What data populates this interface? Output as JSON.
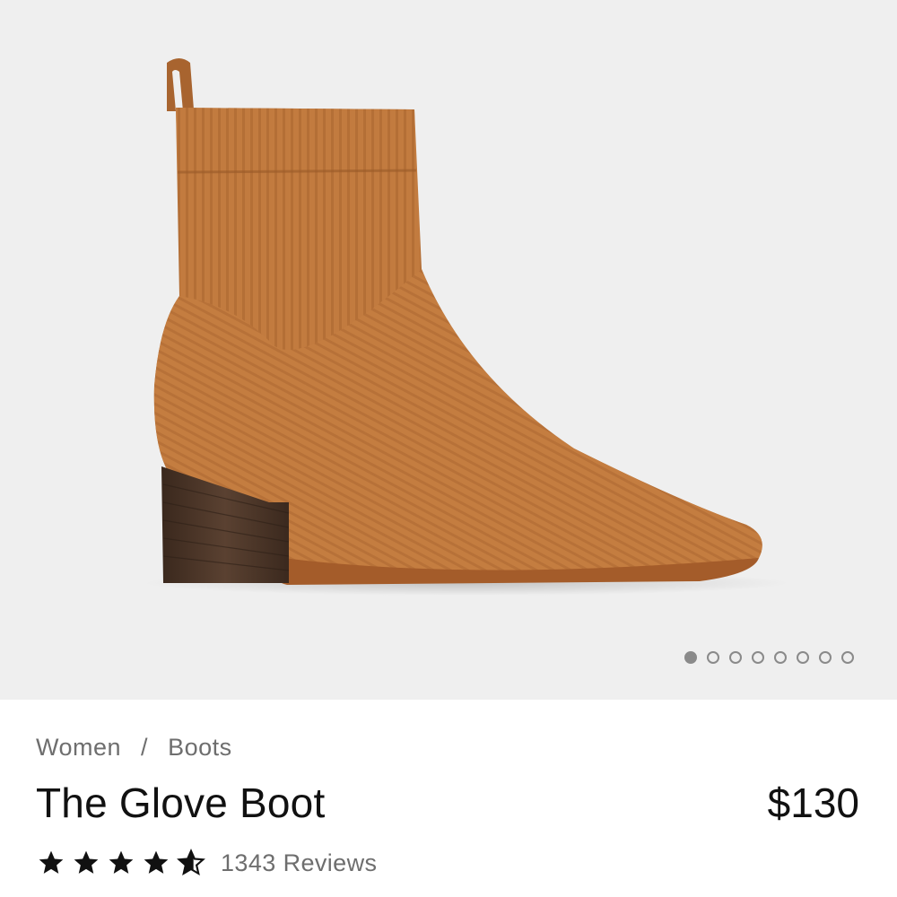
{
  "gallery": {
    "image_alt": "The Glove Boot in cognac ribbed knit with stacked wood heel",
    "image_count": 8,
    "active_index": 0
  },
  "breadcrumb": {
    "items": [
      "Women",
      "Boots"
    ],
    "separator": "/"
  },
  "product": {
    "title": "The Glove Boot",
    "price": "$130"
  },
  "rating": {
    "value": 4.5,
    "max": 5,
    "reviews_label": "1343 Reviews"
  },
  "colors": {
    "boot": "#c07a3e",
    "heel": "#4a3426",
    "text": "#111111",
    "muted": "#6e6e6e",
    "gallery_bg": "#efefef"
  }
}
